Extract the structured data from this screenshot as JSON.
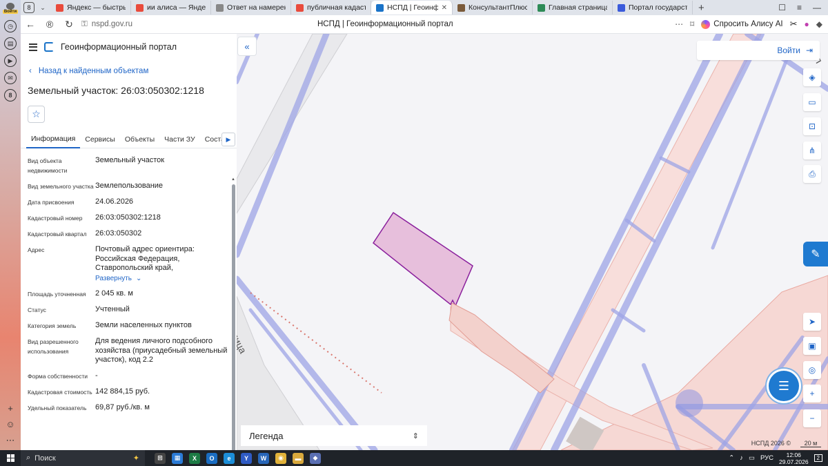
{
  "yandex": {
    "login_label": "Войти",
    "side_badge": "8"
  },
  "browser": {
    "tab_counter": "8",
    "tabs": [
      {
        "title": "Яндекс — быстрый пои",
        "icon": "yandex-icon",
        "color": "#e94b3c"
      },
      {
        "title": "ии алиса — Яндекс: наш",
        "icon": "yandex-icon",
        "color": "#e94b3c"
      },
      {
        "title": "Ответ на намерение уч",
        "icon": "page-icon",
        "color": "#888888"
      },
      {
        "title": "публичная кадастрова",
        "icon": "yandex-icon",
        "color": "#e94b3c"
      },
      {
        "title": "НСПД | Геоинформац",
        "icon": "nspd-icon",
        "color": "#1a73c8",
        "active": true
      },
      {
        "title": "КонсультантПлюс Авто",
        "icon": "consultant-icon",
        "color": "#7a5a3a"
      },
      {
        "title": "Главная страница",
        "icon": "home-icon",
        "color": "#2e8b57"
      },
      {
        "title": "Портал государственн",
        "icon": "flag-icon",
        "color": "#3b5bdb"
      }
    ],
    "url": "nspd.gov.ru",
    "page_title": "НСПД | Геоинформационный портал",
    "alice_label": "Спросить Алису AI"
  },
  "panel": {
    "brand": "Геоинформационный портал",
    "back_label": "Назад к найденным объектам",
    "object_title": "Земельный участок: 26:03:050302:1218",
    "tabs": [
      "Информация",
      "Сервисы",
      "Объекты",
      "Части ЗУ",
      "Состав"
    ],
    "properties": [
      {
        "key": "Вид объекта недвижимости",
        "value": "Земельный участок"
      },
      {
        "key": "Вид земельного участка",
        "value": "Землепользование"
      },
      {
        "key": "Дата присвоения",
        "value": "24.06.2026"
      },
      {
        "key": "Кадастровый номер",
        "value": "26:03:050302:1218"
      },
      {
        "key": "Кадастровый квартал",
        "value": "26:03:050302"
      },
      {
        "key": "Адрес",
        "value": "Почтовый адрес ориентира: Российская Федерация, Ставропольский край,"
      },
      {
        "key": "Площадь уточненная",
        "value": "2 045 кв. м"
      },
      {
        "key": "Статус",
        "value": "Учтенный"
      },
      {
        "key": "Категория земель",
        "value": "Земли населенных пунктов"
      },
      {
        "key": "Вид разрешенного использования",
        "value": "Для ведения личного подсобного хозяйства (приусадебный земельный участок), код 2.2"
      },
      {
        "key": "Форма собственности",
        "value": "-"
      },
      {
        "key": "Кадастровая стоимость",
        "value": "142 884,15 руб."
      },
      {
        "key": "Удельный показатель",
        "value": "69,87 руб./кв. м"
      }
    ],
    "expand_label": "Развернуть"
  },
  "map": {
    "login_label": "Войти",
    "legend_label": "Легенда",
    "copyright": "НСПД 2026 ©",
    "scale": "20 м",
    "street_label": "улица",
    "street_label_top": "пл",
    "parcel_color": "#e7bfdc",
    "parcel_stroke": "#8a1f9c",
    "road_color": "#9ea4e6"
  },
  "taskbar": {
    "search_label": "Поиск",
    "lang": "РУС",
    "time": "12:06",
    "date": "29.07.2026",
    "notif_count": "2"
  }
}
